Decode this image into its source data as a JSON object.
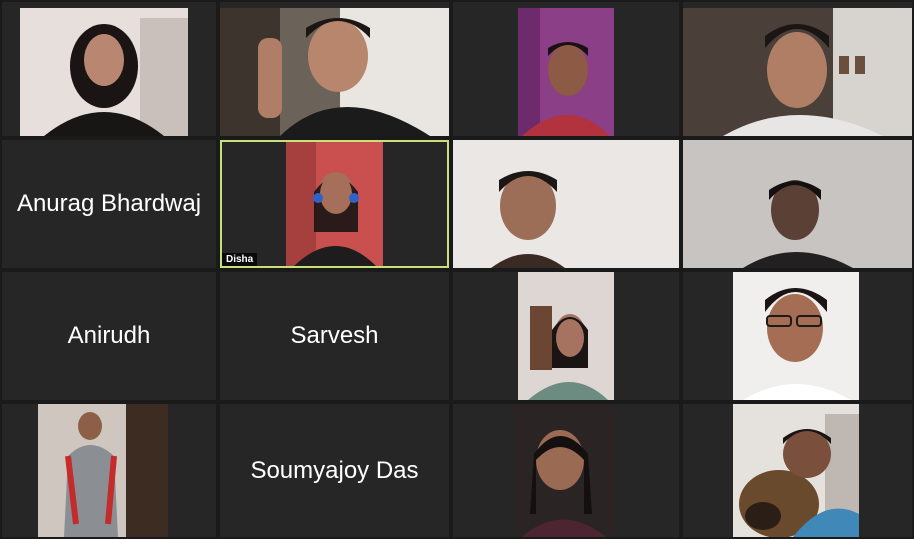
{
  "tiles": [
    {
      "name": "",
      "type": "video"
    },
    {
      "name": "",
      "type": "video"
    },
    {
      "name": "",
      "type": "video"
    },
    {
      "name": "",
      "type": "video"
    },
    {
      "name": "Anurag Bhardwaj",
      "type": "name"
    },
    {
      "name": "Disha",
      "type": "video",
      "active_speaker": true
    },
    {
      "name": "",
      "type": "video"
    },
    {
      "name": "",
      "type": "video"
    },
    {
      "name": "Anirudh",
      "type": "name"
    },
    {
      "name": "Sarvesh",
      "type": "name"
    },
    {
      "name": "",
      "type": "video"
    },
    {
      "name": "",
      "type": "video"
    },
    {
      "name": "",
      "type": "video"
    },
    {
      "name": "Soumyajoy Das",
      "type": "name"
    },
    {
      "name": "",
      "type": "video"
    },
    {
      "name": "",
      "type": "video"
    }
  ],
  "colors": {
    "background": "#1a1a1a",
    "tile": "#262626",
    "active_border": "#c8e07a"
  }
}
